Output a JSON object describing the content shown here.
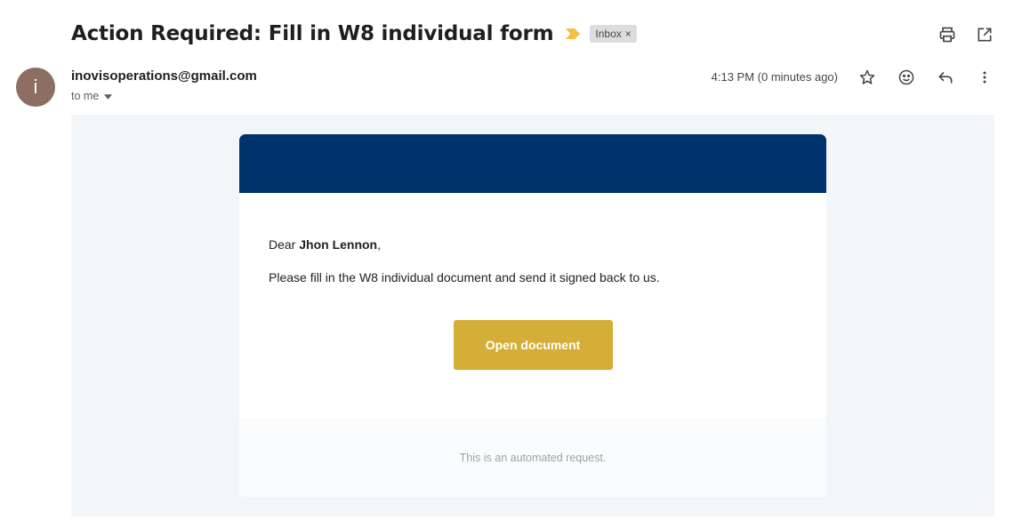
{
  "email": {
    "subject": "Action Required: Fill in W8 individual form",
    "label": "Inbox",
    "label_remove": "×",
    "sender": "inovisoperations@gmail.com",
    "avatar_letter": "i",
    "recipient": "to me",
    "timestamp": "4:13 PM (0 minutes ago)"
  },
  "message": {
    "greeting_prefix": "Dear ",
    "recipient_name": "Jhon Lennon",
    "greeting_suffix": ",",
    "body": "Please fill in the W8 individual document and send it signed back to us.",
    "button_label": "Open document",
    "footer": "This is an automated request."
  },
  "colors": {
    "header_banner": "#00326b",
    "button": "#d4ae36",
    "avatar": "#8d6e63",
    "importance": "#f2c042"
  },
  "icons": {
    "importance": "importance-marker-icon",
    "print": "print-icon",
    "open_new_window": "open-in-new-icon",
    "star": "star-icon",
    "emoji": "emoji-icon",
    "reply": "reply-icon",
    "more": "more-vert-icon",
    "dropdown": "caret-down-icon"
  }
}
